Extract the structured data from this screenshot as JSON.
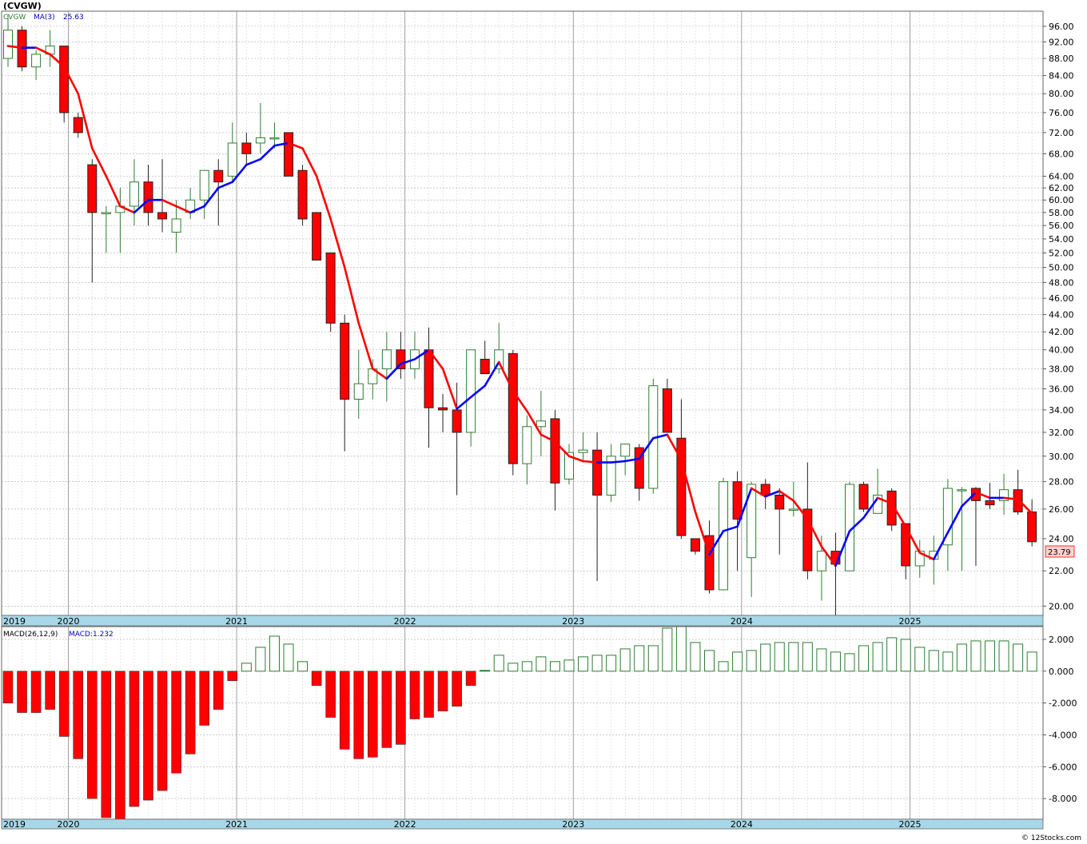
{
  "header": {
    "title": "(CVGW)"
  },
  "price_legend": {
    "symbol": "CVGW",
    "ma_label": "MA(3)",
    "ma_value": "25.63"
  },
  "last_price_label": "23.79",
  "macd_legend": {
    "label": "MACD(26,12,9)",
    "value_label": "MACD:1.232"
  },
  "credit": "© 12Stocks.com",
  "colors": {
    "up_candle": "#2e7d32",
    "down_candle": "#ff0000",
    "ma_up": "#0000ff",
    "ma_down": "#ff0000",
    "grid": "#aaaaaa",
    "axis_band": "#a8d8e8",
    "macd_pos": "#2e7d32",
    "macd_neg": "#ff0000"
  },
  "chart_data": [
    {
      "type": "candlestick",
      "scale": "log",
      "interval": "monthly",
      "series_name": "CVGW",
      "ylim": [
        19.5,
        100
      ],
      "y_ticks": [
        "96.00",
        "92.00",
        "88.00",
        "84.00",
        "80.00",
        "76.00",
        "72.00",
        "68.00",
        "64.00",
        "62.00",
        "60.00",
        "58.00",
        "56.00",
        "54.00",
        "52.00",
        "50.00",
        "48.00",
        "46.00",
        "44.00",
        "42.00",
        "40.00",
        "38.00",
        "36.00",
        "34.00",
        "32.00",
        "30.00",
        "28.00",
        "26.00",
        "24.00",
        "22.00",
        "20.00"
      ],
      "x_ticks": [
        "2019",
        "2020",
        "2021",
        "2022",
        "2023",
        "2024",
        "2025"
      ],
      "x_tick_indices": [
        -0.7,
        4.3,
        16.3,
        28.3,
        40.3,
        52.3,
        64.3
      ],
      "ohlc": [
        [
          88,
          99,
          86,
          95
        ],
        [
          95,
          96,
          85,
          86
        ],
        [
          86,
          90,
          83,
          89
        ],
        [
          89,
          95,
          86,
          91
        ],
        [
          91,
          91,
          74,
          76
        ],
        [
          75,
          76,
          71,
          72
        ],
        [
          66,
          67,
          48,
          58
        ],
        [
          58,
          59,
          52,
          58
        ],
        [
          58,
          62,
          52,
          59
        ],
        [
          59,
          67,
          56,
          63
        ],
        [
          63,
          66,
          56,
          58
        ],
        [
          58,
          67,
          55,
          57
        ],
        [
          55,
          60,
          52,
          57
        ],
        [
          58,
          62,
          57,
          60
        ],
        [
          60,
          63,
          57,
          65
        ],
        [
          65,
          67,
          56,
          63
        ],
        [
          64,
          74,
          63,
          70
        ],
        [
          70,
          72,
          66,
          68
        ],
        [
          70,
          78,
          68,
          71
        ],
        [
          71,
          74,
          69,
          71
        ],
        [
          72,
          72,
          64,
          64
        ],
        [
          65,
          66,
          56,
          57
        ],
        [
          58,
          58,
          51,
          51
        ],
        [
          52,
          52,
          42,
          43
        ],
        [
          43,
          44,
          30.4,
          35
        ],
        [
          35,
          40,
          33.2,
          36.5
        ],
        [
          36.5,
          39,
          35,
          38
        ],
        [
          38,
          42,
          34.8,
          40
        ],
        [
          40,
          42,
          37,
          38
        ],
        [
          38,
          42,
          37,
          40
        ],
        [
          40,
          42.5,
          30.7,
          34.2
        ],
        [
          34.2,
          35.5,
          32,
          34
        ],
        [
          34,
          36.6,
          27,
          32
        ],
        [
          32,
          40,
          30.8,
          40
        ],
        [
          39,
          41,
          38,
          37.5
        ],
        [
          38,
          43,
          37.5,
          40
        ],
        [
          39.6,
          40,
          28.5,
          29.4
        ],
        [
          29.4,
          33.5,
          27.8,
          32.5
        ],
        [
          32.5,
          35.8,
          30,
          33
        ],
        [
          33.2,
          34,
          25.9,
          27.9
        ],
        [
          28.2,
          31,
          27.8,
          30.3
        ],
        [
          30.3,
          32,
          29.5,
          30.5
        ],
        [
          30.5,
          32,
          21.4,
          27
        ],
        [
          27,
          31,
          26.5,
          30
        ],
        [
          30,
          31,
          28.5,
          31
        ],
        [
          30.7,
          31,
          26.6,
          27.5
        ],
        [
          27.5,
          37,
          27.1,
          36.3
        ],
        [
          36,
          37,
          32,
          32
        ],
        [
          31.5,
          35,
          24,
          24.2
        ],
        [
          24,
          24,
          23,
          23.2
        ],
        [
          24.2,
          25.2,
          20.7,
          20.9
        ],
        [
          20.9,
          28.3,
          20.9,
          28
        ],
        [
          28,
          28.8,
          22,
          25.3
        ],
        [
          22.8,
          28,
          20.5,
          27.8
        ],
        [
          27.8,
          28.2,
          26,
          27
        ],
        [
          27,
          27.5,
          23,
          26
        ],
        [
          26,
          28,
          25.5,
          26
        ],
        [
          26,
          29.5,
          21.5,
          22
        ],
        [
          22,
          24.2,
          20.3,
          23.2
        ],
        [
          23.2,
          24.4,
          19.5,
          22.4
        ],
        [
          22,
          28,
          22,
          27.8
        ],
        [
          27.8,
          28,
          25.8,
          26
        ],
        [
          25.7,
          29,
          25.7,
          27
        ],
        [
          27.3,
          27.5,
          24.5,
          24.9
        ],
        [
          25,
          25,
          21.5,
          22.3
        ],
        [
          22.3,
          23.9,
          21.6,
          23.2
        ],
        [
          22.7,
          24.2,
          21.2,
          23.2
        ],
        [
          23.6,
          28.2,
          22,
          27.5
        ],
        [
          27.4,
          27.6,
          22,
          27.4
        ],
        [
          27.5,
          27.6,
          22.3,
          26.6
        ],
        [
          26.6,
          27.9,
          26,
          26.3
        ],
        [
          26.6,
          28.6,
          25.6,
          27.4
        ],
        [
          27.4,
          28.9,
          25.6,
          25.8
        ],
        [
          25.8,
          26.7,
          23.5,
          23.8
        ]
      ],
      "ma3": [
        91,
        90.6,
        90.6,
        89,
        86,
        80,
        69,
        64,
        59,
        58,
        60,
        60,
        59,
        58,
        59,
        62,
        63,
        66,
        67,
        69.5,
        70,
        69,
        64,
        57,
        50,
        43,
        38,
        37,
        38.5,
        39,
        40,
        38,
        34.1,
        35.2,
        36.3,
        38.7,
        35.8,
        33.9,
        31.8,
        31.2,
        30,
        29.6,
        29.5,
        29.5,
        29.6,
        29.8,
        31.5,
        31.8,
        29.7,
        25.8,
        23,
        24.5,
        24.8,
        27.5,
        26.9,
        27.3,
        26.6,
        25.3,
        23.5,
        22.3,
        24.5,
        25.4,
        26.8,
        26.4,
        24.8,
        23.1,
        22.7,
        24.4,
        26.2,
        27.2,
        26.8,
        26.8,
        26.7,
        25.7
      ]
    },
    {
      "type": "bar",
      "series_name": "MACD(26,12,9)",
      "ylim": [
        -9.3,
        2.8
      ],
      "y_ticks": [
        "2.000",
        "0.000",
        "-2.000",
        "-4.000",
        "-6.000",
        "-8.000"
      ],
      "x_ticks": [
        "2019",
        "2020",
        "2021",
        "2022",
        "2023",
        "2024",
        "2025"
      ],
      "values": [
        -2.0,
        -2.6,
        -2.6,
        -2.4,
        -4.1,
        -5.5,
        -8.0,
        -9.2,
        -9.3,
        -8.5,
        -8.1,
        -7.5,
        -6.4,
        -5.2,
        -3.4,
        -2.4,
        -0.6,
        0.5,
        1.5,
        2.2,
        1.7,
        0.6,
        -0.9,
        -2.9,
        -4.9,
        -5.5,
        -5.4,
        -4.8,
        -4.6,
        -3.0,
        -2.9,
        -2.5,
        -2.2,
        -0.9,
        0.05,
        1.0,
        0.5,
        0.6,
        0.9,
        0.6,
        0.7,
        0.9,
        1.0,
        1.0,
        1.4,
        1.6,
        1.6,
        2.7,
        2.8,
        1.8,
        1.3,
        0.6,
        1.2,
        1.3,
        1.7,
        1.8,
        1.8,
        1.8,
        1.4,
        1.2,
        1.1,
        1.6,
        1.8,
        2.1,
        2.0,
        1.5,
        1.3,
        1.2,
        1.7,
        1.9,
        1.9,
        1.9,
        1.7,
        1.2
      ]
    }
  ]
}
